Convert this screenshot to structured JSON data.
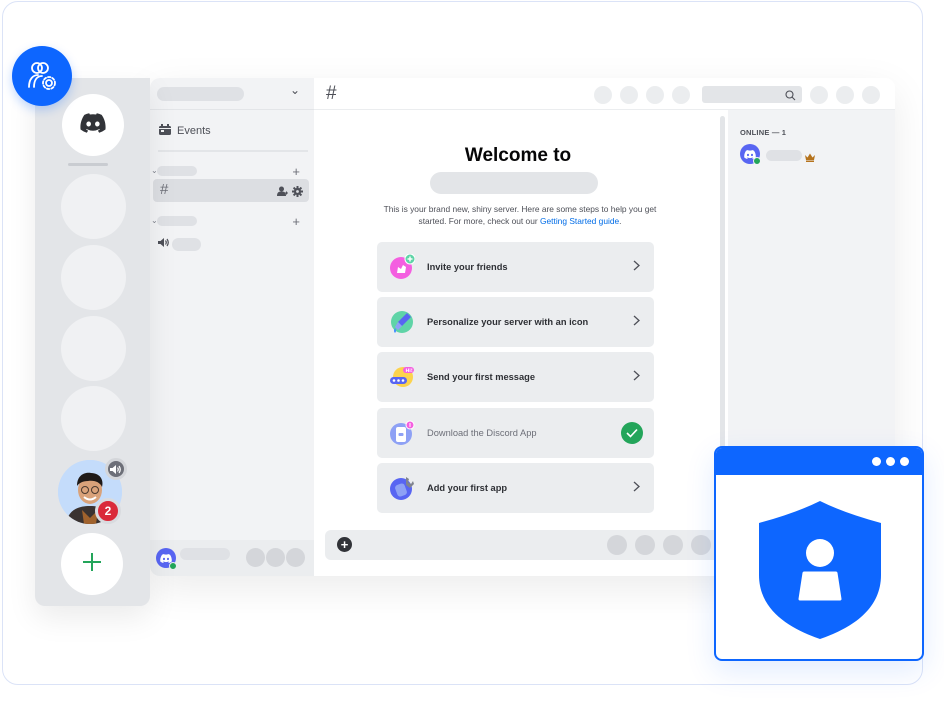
{
  "admin_badge": {
    "icon": "users-gear-icon"
  },
  "server_rail": {
    "home_icon": "discord-logo-icon",
    "server_count_placeholders": 4,
    "user_avatar": {
      "icon": "user-photo-avatar",
      "speaker_icon": "speaker-icon",
      "notification_count": "2"
    },
    "add_server_icon": "plus-icon"
  },
  "channel_sidebar": {
    "events_label": "Events",
    "events_icon": "calendar-icon",
    "text_category": {
      "add_icon": "+",
      "collapse_icon": "chevron-down-icon"
    },
    "selected_channel": {
      "prefix": "#",
      "invite_icon": "add-member-icon",
      "settings_icon": "gear-icon"
    },
    "voice_category": {
      "add_icon": "+"
    },
    "voice_channel": {
      "icon": "speaker-icon"
    },
    "dropdown_icon": "⌄"
  },
  "topbar": {
    "channel_prefix": "#",
    "search_icon": "search-icon"
  },
  "welcome": {
    "title": "Welcome to",
    "description_prefix": "This is your brand new, shiny server. Here are some steps to help you get started. For more, check out our ",
    "guide_link": "Getting Started guide",
    "description_suffix": "."
  },
  "steps": [
    {
      "label": "Invite your friends",
      "icon": "invite-friends-icon",
      "completed": false,
      "color": "#f45fe0"
    },
    {
      "label": "Personalize your server with an icon",
      "icon": "paintbrush-icon",
      "completed": false,
      "color": "#5fd4a7"
    },
    {
      "label": "Send your first message",
      "icon": "message-icon",
      "completed": false,
      "color": "#fcd34d"
    },
    {
      "label": "Download the Discord App",
      "icon": "phone-app-icon",
      "completed": true,
      "color": "#8ea1f5"
    },
    {
      "label": "Add your first app",
      "icon": "app-wrench-icon",
      "completed": false,
      "color": "#5865f2"
    }
  ],
  "composer": {
    "attach_icon": "plus-circle-icon"
  },
  "members": {
    "heading": "ONLINE — 1",
    "owner_icon": "crown-icon"
  },
  "security_card": {
    "icon": "shield-user-icon"
  },
  "colors": {
    "brand_blue": "#0d66ff",
    "discord_blurple": "#5865f2",
    "online_green": "#23a55a",
    "badge_red": "#da2a3a",
    "link_blue": "#006ce7"
  }
}
